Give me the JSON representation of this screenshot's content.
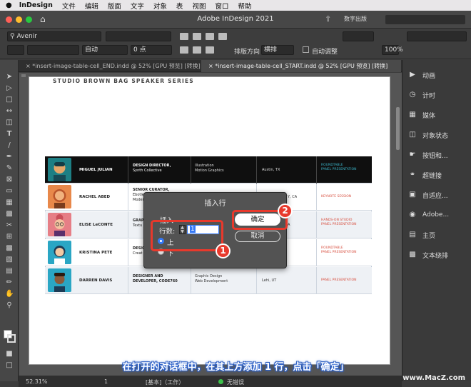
{
  "menubar": {
    "apple": "",
    "app": "InDesign",
    "items": [
      "文件",
      "编辑",
      "版面",
      "文字",
      "对象",
      "表",
      "视图",
      "窗口",
      "帮助"
    ]
  },
  "titlebar": {
    "title": "Adobe InDesign 2021",
    "workspace": "数字出版"
  },
  "control": {
    "font": "Avenir",
    "leading": "自动",
    "tracking": "0 点",
    "layout_dir_label": "排版方向",
    "layout_dir": "横排",
    "auto_adjust": "自动调整",
    "zoom": "100%"
  },
  "tabs": [
    {
      "label": "*insert-image-table-cell_END.indd @ 52% [GPU 预览] [转换]"
    },
    {
      "label": "*insert-image-table-cell_START.indd @ 52% [GPU 预览] [转换]"
    }
  ],
  "doc": {
    "header": "STUDIO BROWN BAG SPEAKER SERIES",
    "rows": [
      {
        "name": "MIGUEL JULIAN",
        "title": [
          "DESIGN DIRECTOR,",
          "Synth Collective"
        ],
        "topic": [
          "Illustration",
          "Motion Graphics"
        ],
        "loc": "Austin, TX",
        "type": [
          "ROUNDTABLE",
          "PANEL PRESENTATION"
        ],
        "color": "#1d7f84"
      },
      {
        "name": "RACHEL ABED",
        "title": [
          "SENIOR CURATOR,",
          "Ebotle Museum of",
          "Modern Art"
        ],
        "topic": [
          ""
        ],
        "loc": "Y, CA",
        "type": [
          "KEYNOTE SESSION"
        ],
        "color": "#e8884a"
      },
      {
        "name": "ELISE LeCONTE",
        "title": [
          "GRAP",
          "Textu"
        ],
        "topic": [
          ""
        ],
        "loc": "A",
        "type": [
          "HANDS-ON STUDIO",
          "PANEL PRESENTATION"
        ],
        "color": "#e67e86"
      },
      {
        "name": "KRISTINA PETE",
        "title": [
          "DESIG",
          "Creat"
        ],
        "topic": [
          ""
        ],
        "loc": "",
        "type": [
          "ROUNDTABLE",
          "PANEL PRESENTATION"
        ],
        "color": "#2aa6c4"
      },
      {
        "name": "DARREN DAVIS",
        "title": [
          "DESIGNER AND",
          "DEVELOPER, CODE760"
        ],
        "topic": [
          "Graphic Design",
          "Web Development"
        ],
        "loc": "Lehi, UT",
        "type": [
          "PANEL PRESENTATION"
        ],
        "color": "#2aa6c4"
      }
    ]
  },
  "dialog": {
    "title": "插入行",
    "group": "插入",
    "rows_label": "行数:",
    "rows_value": "1",
    "above": "上",
    "below": "下",
    "ok": "确定",
    "cancel": "取消"
  },
  "panel": {
    "items": [
      {
        "label": "动画",
        "icon": "animation-icon"
      },
      {
        "label": "计时",
        "icon": "timer-icon"
      },
      {
        "label": "媒体",
        "icon": "media-icon"
      },
      {
        "label": "对象状态",
        "icon": "object-states-icon"
      },
      {
        "label": "按钮和...",
        "icon": "buttons-icon"
      },
      {
        "label": "超链接",
        "icon": "hyperlink-icon"
      },
      {
        "label": "自适应...",
        "icon": "liquid-layout-icon"
      },
      {
        "label": "Adobe...",
        "icon": "adobe-icon"
      },
      {
        "label": "主页",
        "icon": "pages-icon"
      },
      {
        "label": "文本绕排",
        "icon": "text-wrap-icon"
      }
    ]
  },
  "status": {
    "zoom": "52.31%",
    "page": "1",
    "style": "[基本]（工作）",
    "errors": "无错误"
  },
  "annotations": {
    "caption": "在打开的对话框中，在其上方添加 1 行，点击「确定」",
    "badge1": "1",
    "badge2": "2",
    "watermark": "www.MacZ.com"
  }
}
